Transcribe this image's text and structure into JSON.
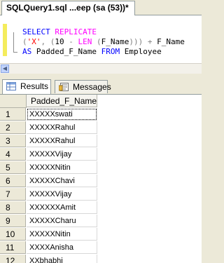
{
  "document_tab": {
    "title": "SQLQuery1.sql ...eep (sa (53))*"
  },
  "editor": {
    "line1": {
      "kw": "SELECT",
      "fn": "REPLICATE"
    },
    "line2": {
      "open": "(",
      "str": "'X'",
      "comma": ",",
      "open2": "(",
      "num": "10",
      "minus": "-",
      "fn": "LEN",
      "open3": "(",
      "field": "F_Name",
      "close": ")))",
      "plus": "+",
      "field2": "F_Name"
    },
    "line3": {
      "kw_as": "AS",
      "alias": "Padded_F_Name",
      "kw_from": "FROM",
      "table": "Employee"
    }
  },
  "result_tabs": {
    "results_label": "Results",
    "messages_label": "Messages"
  },
  "grid": {
    "column_header": "Padded_F_Name",
    "rows": [
      {
        "num": "1",
        "value": "XXXXXswati"
      },
      {
        "num": "2",
        "value": "XXXXXRahul"
      },
      {
        "num": "3",
        "value": "XXXXXRahul"
      },
      {
        "num": "4",
        "value": "XXXXXVijay"
      },
      {
        "num": "5",
        "value": "XXXXXNitin"
      },
      {
        "num": "6",
        "value": "XXXXXChavi"
      },
      {
        "num": "7",
        "value": "XXXXXVijay"
      },
      {
        "num": "8",
        "value": "XXXXXXAmit"
      },
      {
        "num": "9",
        "value": "XXXXXCharu"
      },
      {
        "num": "10",
        "value": "XXXXXNitin"
      },
      {
        "num": "11",
        "value": "XXXXAnisha"
      },
      {
        "num": "12",
        "value": "XXbhabhi"
      }
    ]
  },
  "colors": {
    "keyword": "#0000ff",
    "function": "#ff00ff",
    "string": "#ff0000",
    "operator": "#808080"
  }
}
